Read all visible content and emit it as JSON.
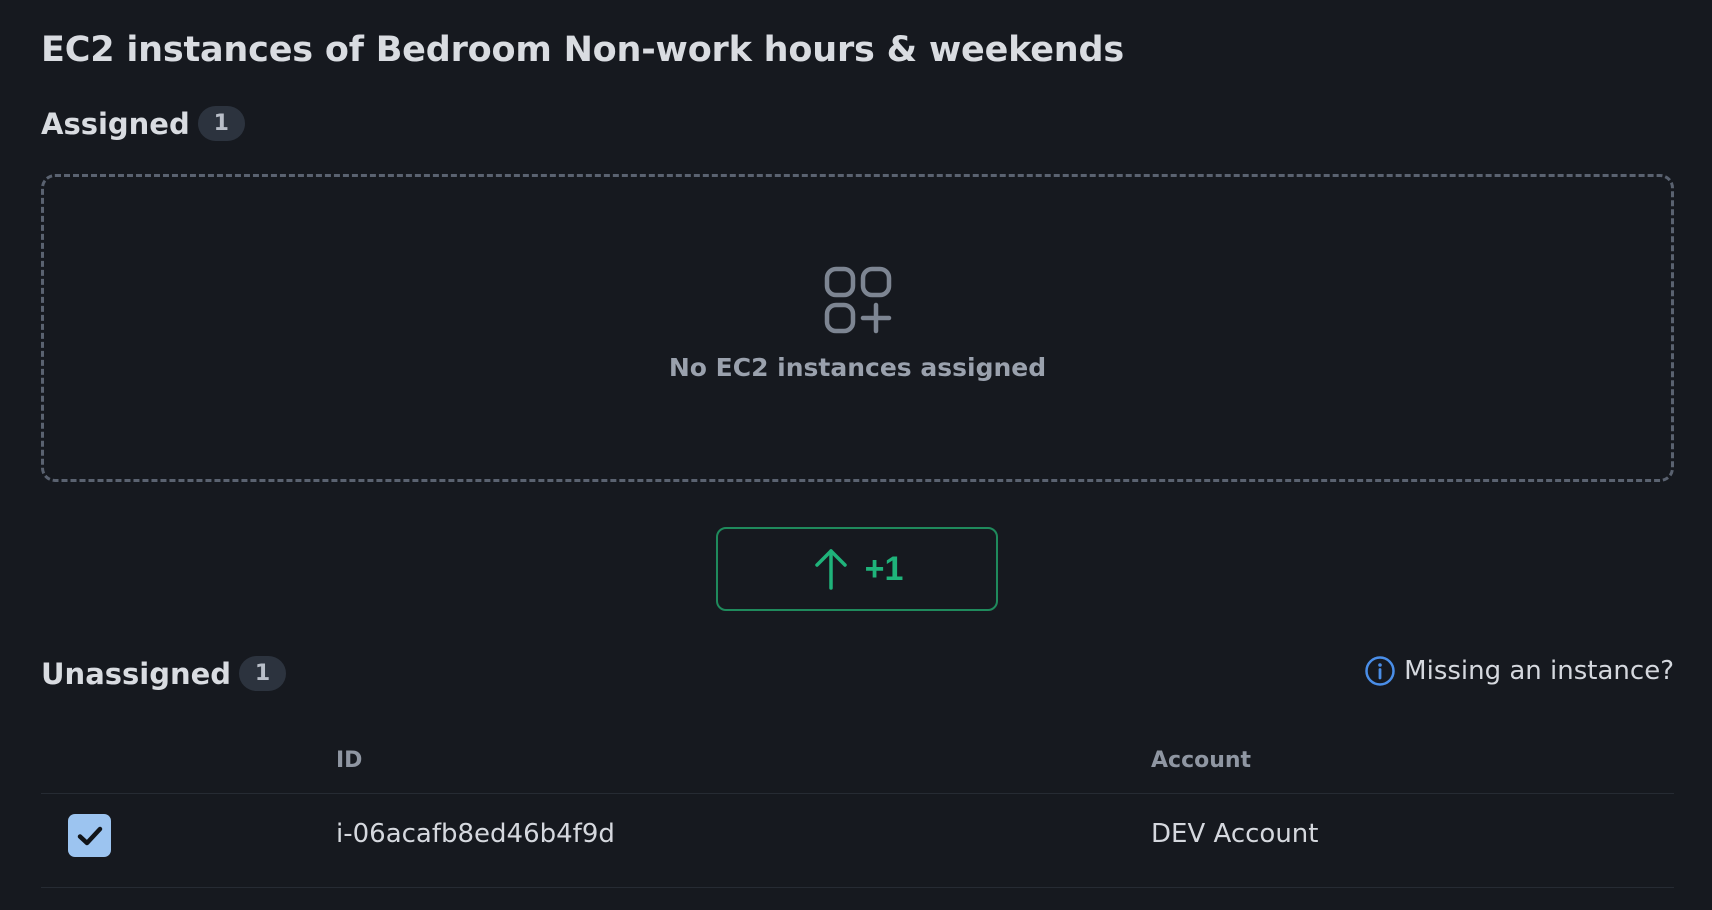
{
  "page": {
    "title": "EC2 instances of Bedroom Non-work hours & weekends"
  },
  "assigned": {
    "label": "Assigned",
    "count": "1",
    "empty_icon": "apps-add-icon",
    "empty_text": "No EC2 instances assigned"
  },
  "move_button": {
    "icon": "arrow-up-icon",
    "label": "+1"
  },
  "unassigned": {
    "label": "Unassigned",
    "count": "1",
    "missing_link": {
      "icon": "info-icon",
      "text": "Missing an instance?"
    },
    "table": {
      "columns": [
        "ID",
        "Account"
      ],
      "rows": [
        {
          "selected": true,
          "id": "i-06acafb8ed46b4f9d",
          "account": "DEV Account"
        }
      ]
    }
  },
  "colors": {
    "background": "#16191f",
    "accent_green": "#1fb37a",
    "checkbox_blue": "#9cc4f0",
    "info_blue": "#4a8ee8"
  }
}
